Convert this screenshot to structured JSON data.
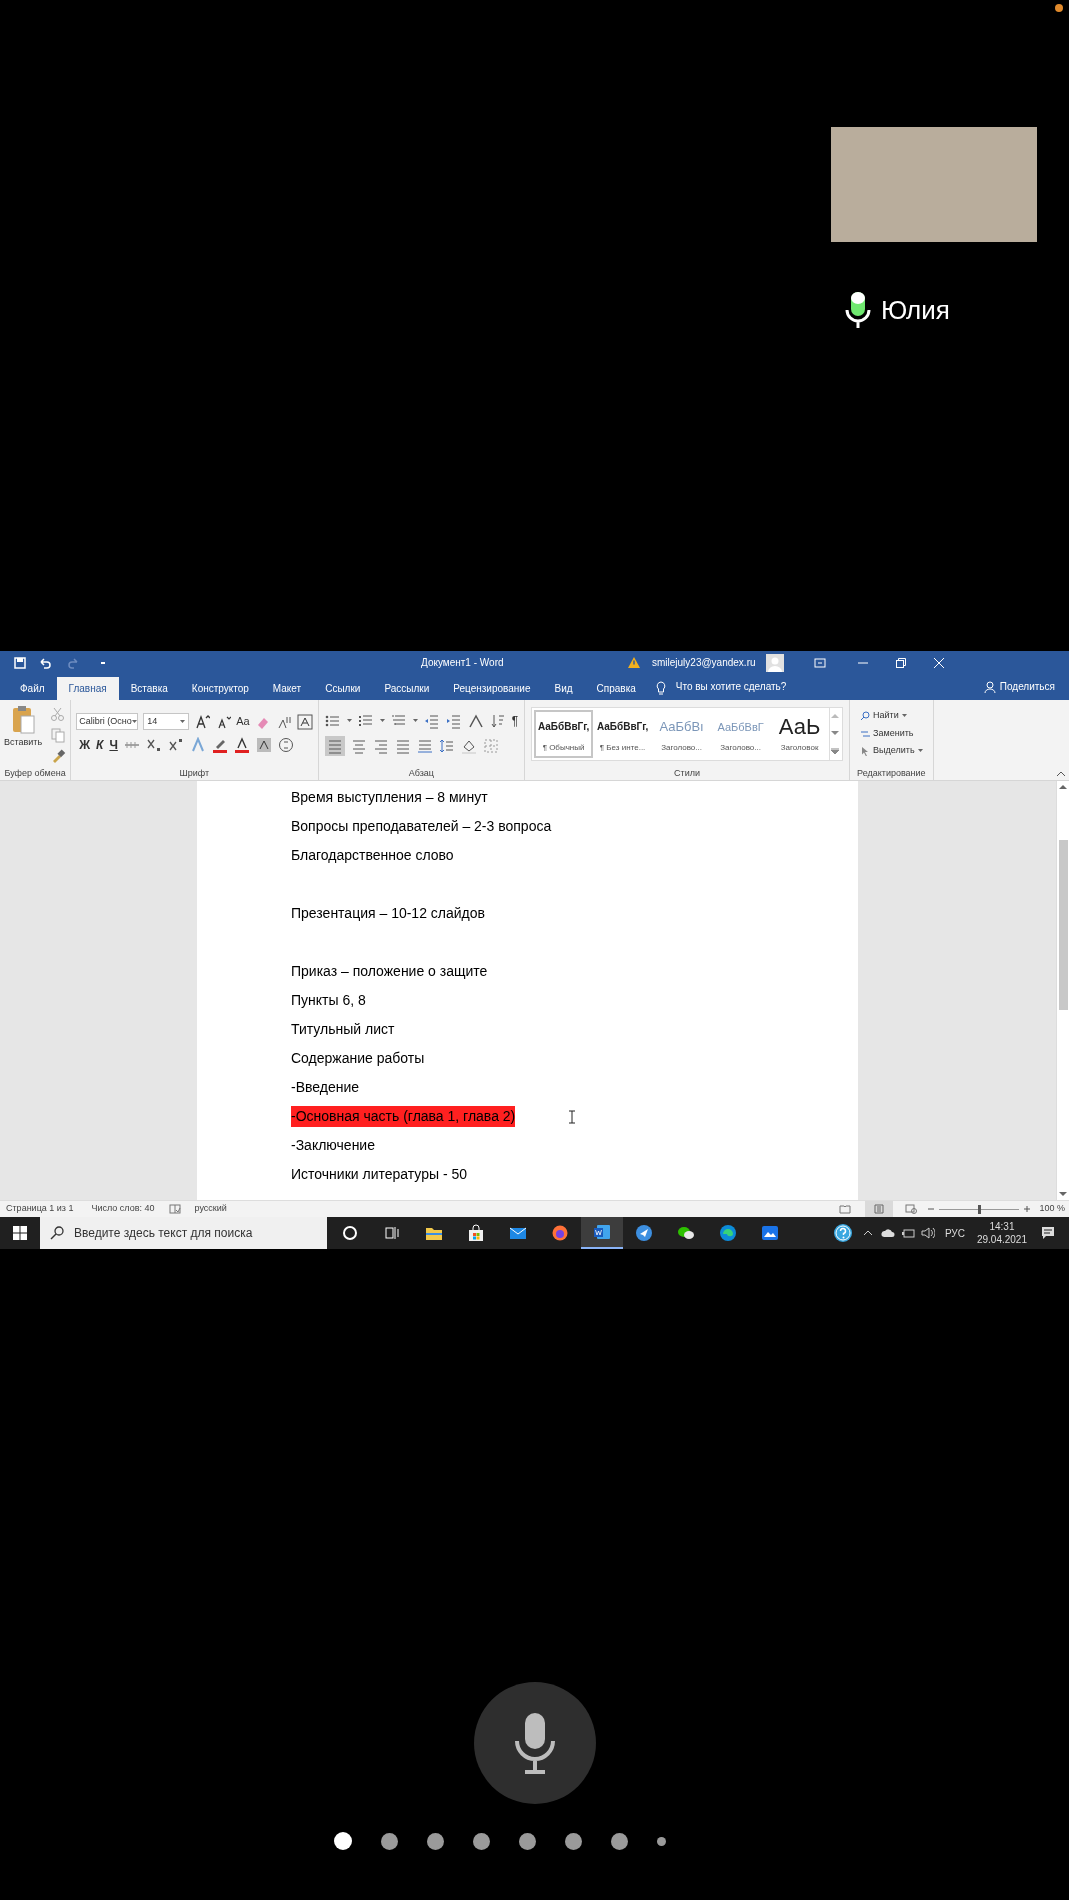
{
  "call": {
    "participant": {
      "name": "Юлия",
      "mic_on": true
    },
    "page_dots": [
      {
        "selected": true
      },
      {
        "selected": false
      },
      {
        "selected": false
      },
      {
        "selected": false
      },
      {
        "selected": false
      },
      {
        "selected": false
      },
      {
        "selected": false
      },
      {
        "selected": false
      }
    ]
  },
  "word": {
    "window": {
      "title": "Документ1  -  Word",
      "account": "smilejuly23@yandex.ru"
    },
    "tabs": [
      {
        "label": "Файл",
        "selected": false
      },
      {
        "label": "Главная",
        "selected": true
      },
      {
        "label": "Вставка",
        "selected": false
      },
      {
        "label": "Конструктор",
        "selected": false
      },
      {
        "label": "Макет",
        "selected": false
      },
      {
        "label": "Ссылки",
        "selected": false
      },
      {
        "label": "Рассылки",
        "selected": false
      },
      {
        "label": "Рецензирование",
        "selected": false
      },
      {
        "label": "Вид",
        "selected": false
      },
      {
        "label": "Справка",
        "selected": false
      }
    ],
    "tell_me": "Что вы хотите сделать?",
    "share": "Поделиться",
    "ribbon": {
      "clipboard": {
        "paste": "Вставить",
        "label": "Буфер обмена"
      },
      "font": {
        "font_name": "Calibri (Осно",
        "font_size": "14",
        "change_case": "Aa",
        "format_buttons": [
          "Ж",
          "К",
          "Ч"
        ],
        "label": "Шрифт"
      },
      "paragraph": {
        "show_marks": "¶",
        "label": "Абзац"
      },
      "styles": {
        "items": [
          {
            "preview": "АаБбВвГг,",
            "name": "¶ Обычный",
            "kind": "bold",
            "selected": true
          },
          {
            "preview": "АаБбВвГг,",
            "name": "¶ Без инте...",
            "kind": "bold",
            "selected": false
          },
          {
            "preview": "АаБбВı",
            "name": "Заголово...",
            "kind": "heading",
            "selected": false
          },
          {
            "preview": "АаБбВвГ",
            "name": "Заголово...",
            "kind": "heading-small",
            "selected": false
          },
          {
            "preview": "АаЬ",
            "name": "Заголовок",
            "kind": "title",
            "selected": false
          }
        ],
        "label": "Стили"
      },
      "editing": {
        "find": "Найти",
        "replace": "Заменить",
        "select": "Выделить",
        "label": "Редактирование"
      }
    },
    "document": {
      "lines": [
        {
          "kind": "text",
          "text": "Время выступления – 8 минут",
          "highlighted": false
        },
        {
          "kind": "text",
          "text": "Вопросы преподавателей – 2-3 вопроса",
          "highlighted": false
        },
        {
          "kind": "text",
          "text": "Благодарственное слово",
          "highlighted": false
        },
        {
          "kind": "blank"
        },
        {
          "kind": "text",
          "text": "Презентация – 10-12 слайдов",
          "highlighted": false
        },
        {
          "kind": "blank"
        },
        {
          "kind": "text",
          "text": "Приказ – положение о защите",
          "highlighted": false
        },
        {
          "kind": "text",
          "text": "Пункты 6, 8",
          "highlighted": false
        },
        {
          "kind": "text",
          "text": "Титульный лист",
          "highlighted": false
        },
        {
          "kind": "text",
          "text": "Содержание работы",
          "highlighted": false
        },
        {
          "kind": "text",
          "text": "-Введение",
          "highlighted": false
        },
        {
          "kind": "text",
          "text": "-Основная часть (глава 1, глава 2)",
          "highlighted": true
        },
        {
          "kind": "text",
          "text": "-Заключение",
          "highlighted": false
        },
        {
          "kind": "text",
          "text": "Источники литературы - 50",
          "highlighted": false
        }
      ]
    },
    "status_bar": {
      "page": "Страница 1 из 1",
      "words": "Число слов: 40",
      "language": "русский",
      "zoom": "100 %",
      "zoom_slider": {
        "level": 0.5
      }
    }
  },
  "taskbar": {
    "search_placeholder": "Введите здесь текст для поиска",
    "apps": [
      {
        "kind": "cortana",
        "selected": false
      },
      {
        "kind": "task-view",
        "selected": false
      },
      {
        "kind": "folder",
        "selected": false
      },
      {
        "kind": "store",
        "selected": false
      },
      {
        "kind": "mail",
        "selected": false
      },
      {
        "kind": "firefox",
        "selected": false
      },
      {
        "kind": "word",
        "selected": true
      },
      {
        "kind": "bird",
        "selected": false
      },
      {
        "kind": "chat",
        "selected": false
      },
      {
        "kind": "edge",
        "selected": false
      },
      {
        "kind": "photos",
        "selected": false
      }
    ],
    "language": "РУС",
    "time": "14:31",
    "date": "29.04.2021"
  }
}
